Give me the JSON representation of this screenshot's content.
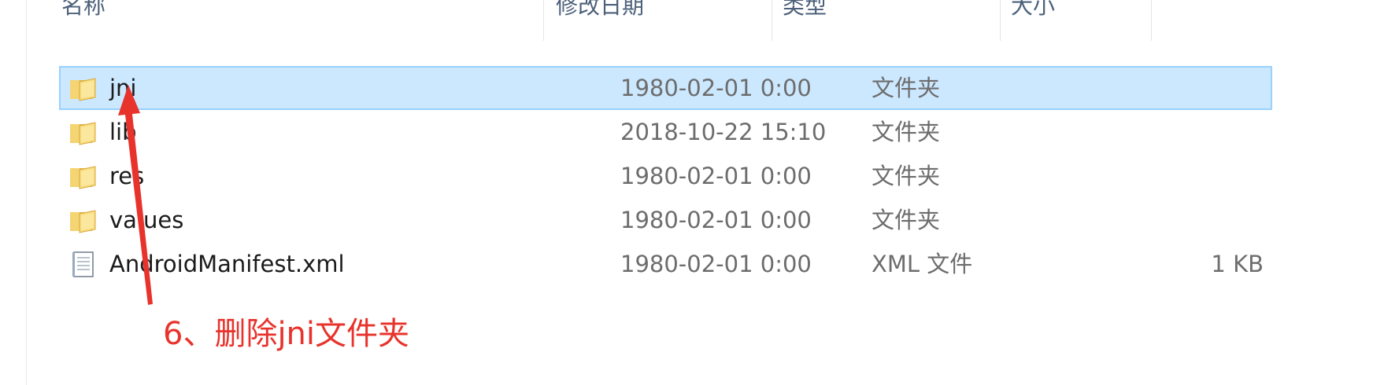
{
  "header": {
    "columns": [
      "名称",
      "修改日期",
      "类型",
      "大小"
    ]
  },
  "files": [
    {
      "name": "jni",
      "date": "1980-02-01 0:00",
      "type": "文件夹",
      "size": "",
      "icon": "folder-icon",
      "selected": true
    },
    {
      "name": "lib",
      "date": "2018-10-22 15:10",
      "type": "文件夹",
      "size": "",
      "icon": "folder-icon",
      "selected": false
    },
    {
      "name": "res",
      "date": "1980-02-01 0:00",
      "type": "文件夹",
      "size": "",
      "icon": "folder-icon",
      "selected": false
    },
    {
      "name": "values",
      "date": "1980-02-01 0:00",
      "type": "文件夹",
      "size": "",
      "icon": "folder-icon",
      "selected": false
    },
    {
      "name": "AndroidManifest.xml",
      "date": "1980-02-01 0:00",
      "type": "XML 文件",
      "size": "1 KB",
      "icon": "xml-file-icon",
      "selected": false
    }
  ],
  "annotation": {
    "text": "6、删除jni文件夹",
    "color": "#e8332c"
  },
  "colors": {
    "selection_bg": "#cce8ff",
    "selection_border": "#99d1ff"
  }
}
